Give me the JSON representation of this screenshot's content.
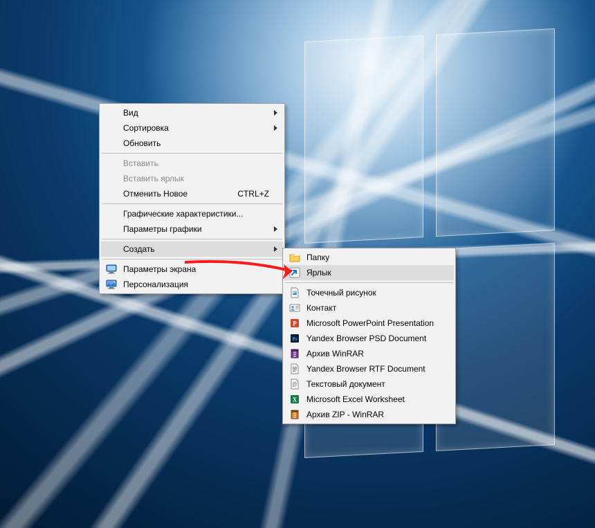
{
  "main_menu": {
    "view": {
      "label": "Вид",
      "submenu": true
    },
    "sort": {
      "label": "Сортировка",
      "submenu": true
    },
    "refresh": {
      "label": "Обновить"
    },
    "paste": {
      "label": "Вставить",
      "disabled": true
    },
    "paste_shortcut": {
      "label": "Вставить ярлык",
      "disabled": true
    },
    "undo": {
      "label": "Отменить Новое",
      "accel": "CTRL+Z"
    },
    "gfx_props": {
      "label": "Графические характеристики..."
    },
    "gfx_params": {
      "label": "Параметры графики",
      "submenu": true
    },
    "new": {
      "label": "Создать",
      "submenu": true,
      "hover": true
    },
    "display": {
      "label": "Параметры экрана",
      "icon": "display"
    },
    "personalize": {
      "label": "Персонализация",
      "icon": "personalize"
    }
  },
  "sub_menu": {
    "folder": {
      "label": "Папку",
      "icon": "folder"
    },
    "shortcut": {
      "label": "Ярлык",
      "icon": "shortcut",
      "hover": true
    },
    "bmp": {
      "label": "Точечный рисунок",
      "icon": "bmp"
    },
    "contact": {
      "label": "Контакт",
      "icon": "contact"
    },
    "ppt": {
      "label": "Microsoft PowerPoint Presentation",
      "icon": "ppt"
    },
    "psd": {
      "label": "Yandex Browser PSD Document",
      "icon": "psd"
    },
    "rar": {
      "label": "Архив WinRAR",
      "icon": "rar"
    },
    "rtf": {
      "label": "Yandex Browser RTF Document",
      "icon": "rtf"
    },
    "txt": {
      "label": "Текстовый документ",
      "icon": "txt"
    },
    "xls": {
      "label": "Microsoft Excel Worksheet",
      "icon": "xls"
    },
    "zip": {
      "label": "Архив ZIP - WinRAR",
      "icon": "zip"
    }
  }
}
